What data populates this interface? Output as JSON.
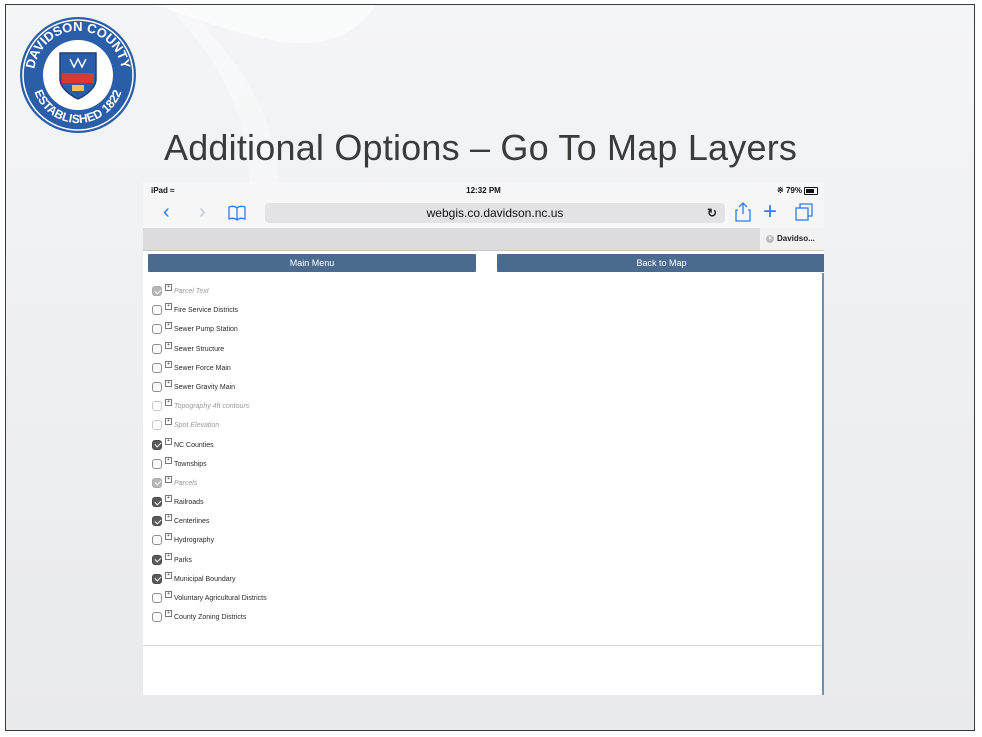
{
  "slide": {
    "title": "Additional Options – Go To Map Layers",
    "seal": {
      "top_text": "DAVIDSON COUNTY",
      "bottom_text": "ESTABLISHED 1822"
    }
  },
  "ipad": {
    "status": {
      "device": "iPad",
      "time": "12:32 PM",
      "battery": "79%"
    },
    "url": "webgis.co.davidson.nc.us",
    "tab_label": "Davidso...",
    "icons": [
      "back-icon",
      "forward-icon",
      "bookmarks-icon",
      "reload-icon",
      "share-icon",
      "new-tab-icon",
      "tabs-icon"
    ]
  },
  "page": {
    "main_menu_label": "Main Menu",
    "back_to_map_label": "Back to Map",
    "layers": [
      {
        "label": "Parcel Text",
        "state": "checked",
        "enabled": false
      },
      {
        "label": "Fire Service Districts",
        "state": "unchecked",
        "enabled": true
      },
      {
        "label": "Sewer Pump Station",
        "state": "unchecked",
        "enabled": true
      },
      {
        "label": "Sewer Structure",
        "state": "unchecked",
        "enabled": true
      },
      {
        "label": "Sewer Force Main",
        "state": "unchecked",
        "enabled": true
      },
      {
        "label": "Sewer Gravity Main",
        "state": "unchecked",
        "enabled": true
      },
      {
        "label": "Topography 4ft contours",
        "state": "unchecked",
        "enabled": false
      },
      {
        "label": "Spot Elevation",
        "state": "unchecked",
        "enabled": false
      },
      {
        "label": "NC Counties",
        "state": "checked",
        "enabled": true
      },
      {
        "label": "Townships",
        "state": "unchecked",
        "enabled": true
      },
      {
        "label": "Parcels",
        "state": "checked",
        "enabled": false
      },
      {
        "label": "Railroads",
        "state": "checked",
        "enabled": true
      },
      {
        "label": "Centerlines",
        "state": "checked",
        "enabled": true
      },
      {
        "label": "Hydrography",
        "state": "unchecked",
        "enabled": true
      },
      {
        "label": "Parks",
        "state": "checked",
        "enabled": true
      },
      {
        "label": "Municipal Boundary",
        "state": "checked",
        "enabled": true
      },
      {
        "label": "Voluntary Agricultural Districts",
        "state": "unchecked",
        "enabled": true
      },
      {
        "label": "County Zoning Districts",
        "state": "unchecked",
        "enabled": true
      }
    ]
  },
  "colors": {
    "button": "#4a6a90",
    "accent": "#2f7bf6",
    "title": "#3b3b3b"
  }
}
